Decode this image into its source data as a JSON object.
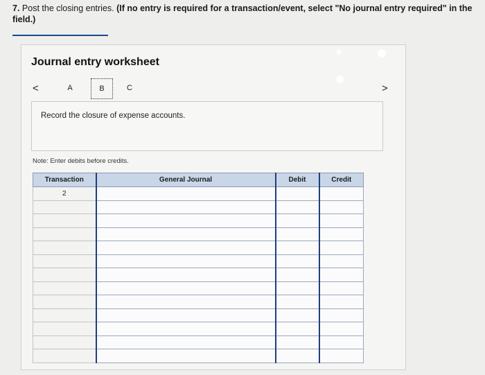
{
  "question": {
    "number": "7.",
    "text": " Post the closing entries. ",
    "bold_line1": "(If no entry is required for a transaction/event, select \"No journal entry required\" in the",
    "bold_line2": "field.)"
  },
  "worksheet": {
    "title": "Journal entry worksheet",
    "nav_prev": "<",
    "nav_next": ">",
    "tabs": [
      {
        "label": "A",
        "selected": false
      },
      {
        "label": "B",
        "selected": true
      },
      {
        "label": "C",
        "selected": false
      }
    ],
    "instruction": "Record the closure of expense accounts.",
    "note": "Note: Enter debits before credits.",
    "table": {
      "headers": {
        "transaction": "Transaction",
        "general_journal": "General Journal",
        "debit": "Debit",
        "credit": "Credit"
      },
      "first_transaction": "2",
      "row_count": 13
    }
  },
  "colors": {
    "header_bg": "#c9d6e8",
    "accent_border": "#1d3f7a",
    "underline": "#1c4a8a"
  }
}
